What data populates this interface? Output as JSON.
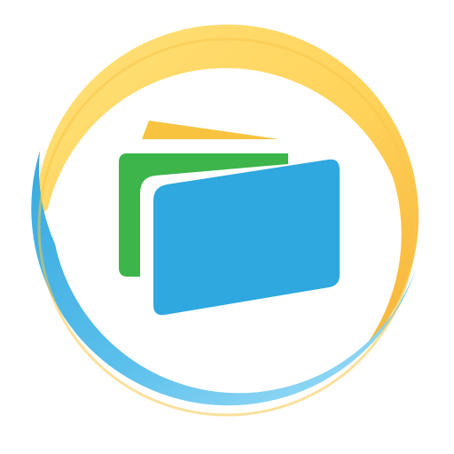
{
  "icon": {
    "name": "stacked-cards-app-icon",
    "colors": {
      "background": "#ffffff",
      "ring_yellow": "#ffd35a",
      "ring_orange": "#f6b33a",
      "ring_blue": "#37a9df",
      "ring_light_blue": "#9fdcf7",
      "card_back_yellow": "#f8c33f",
      "card_middle_green": "#3db54a",
      "card_front_blue": "#2ea8df"
    }
  }
}
